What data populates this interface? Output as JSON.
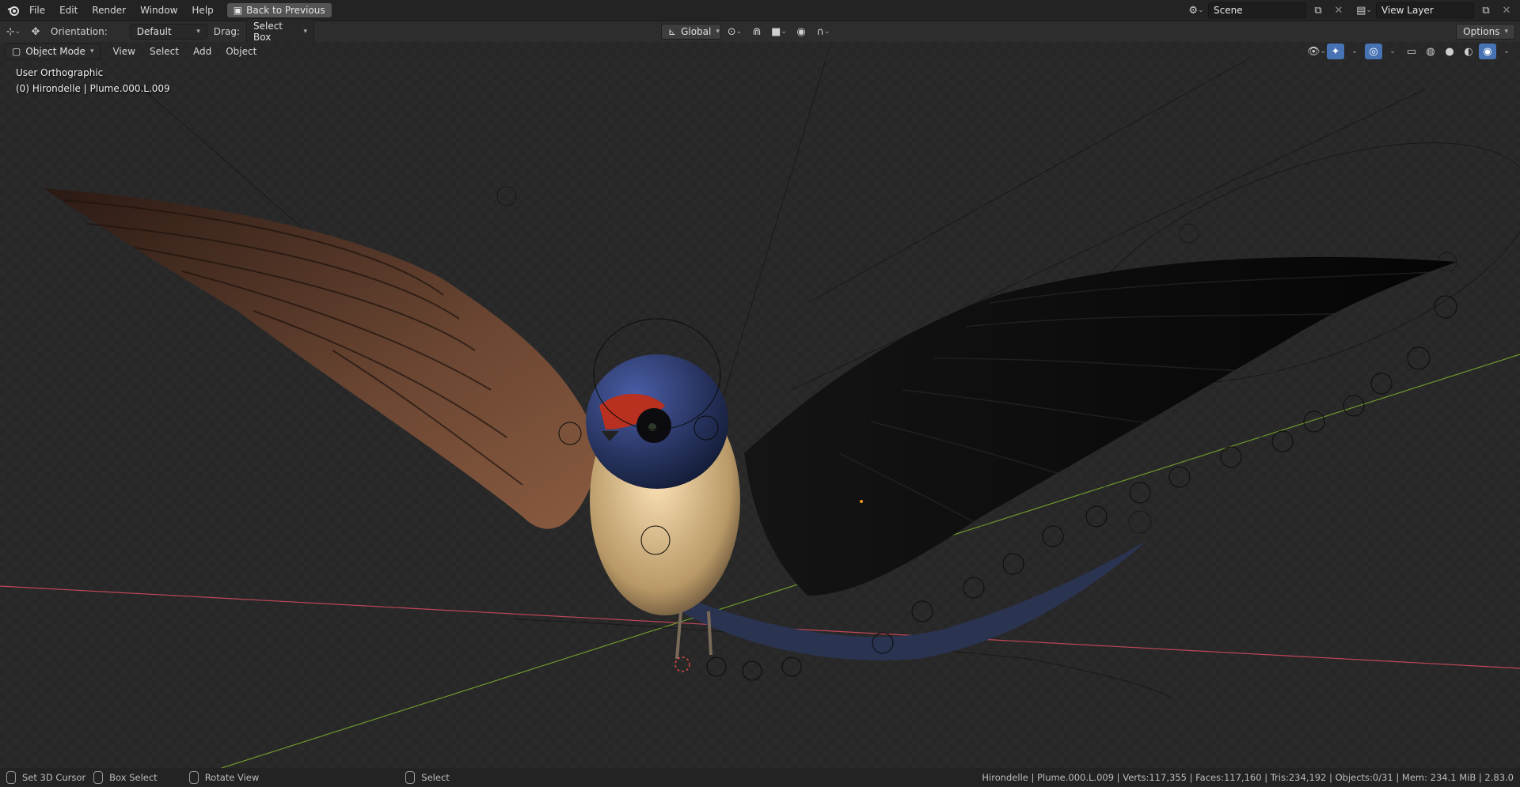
{
  "topbar": {
    "menus": [
      "File",
      "Edit",
      "Render",
      "Window",
      "Help"
    ],
    "back_button": "Back to Previous",
    "scene_name": "Scene",
    "view_layer_name": "View Layer"
  },
  "toolbar": {
    "orientation_label": "Orientation:",
    "orientation_value": "Default",
    "drag_label": "Drag:",
    "drag_value": "Select Box",
    "transform_orientation": "Global",
    "options_label": "Options"
  },
  "header": {
    "mode": "Object Mode",
    "menus": [
      "View",
      "Select",
      "Add",
      "Object"
    ]
  },
  "viewport": {
    "view_name": "User Orthographic",
    "active_object": "(0) Hirondelle | Plume.000.L.009"
  },
  "statusbar": {
    "set_cursor": "Set 3D Cursor",
    "box_select": "Box Select",
    "rotate_view": "Rotate View",
    "select": "Select",
    "stats": "Hirondelle | Plume.000.L.009 | Verts:117,355 | Faces:117,160 | Tris:234,192 | Objects:0/31 | Mem: 234.1 MiB | 2.83.0"
  },
  "colors": {
    "accent": "#4772b3",
    "x_axis": "#c0465a",
    "y_axis": "#6e9a2c"
  }
}
